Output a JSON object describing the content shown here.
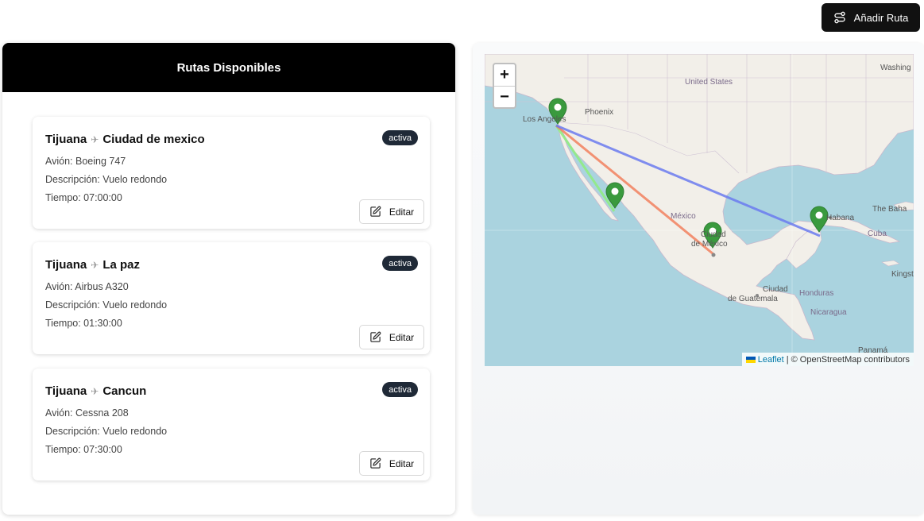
{
  "header": {
    "add_route_label": "Añadir Ruta"
  },
  "routes_panel": {
    "title": "Rutas Disponibles",
    "routes": [
      {
        "origin": "Tijuana",
        "destination": "Ciudad de mexico",
        "status": "activa",
        "aircraft": "Avión: Boeing 747",
        "description": "Descripción: Vuelo redondo",
        "time": "Tiempo: 07:00:00",
        "edit_label": "Editar"
      },
      {
        "origin": "Tijuana",
        "destination": "La paz",
        "status": "activa",
        "aircraft": "Avión: Airbus A320",
        "description": "Descripción: Vuelo redondo",
        "time": "Tiempo: 01:30:00",
        "edit_label": "Editar"
      },
      {
        "origin": "Tijuana",
        "destination": "Cancun",
        "status": "activa",
        "aircraft": "Avión: Cessna 208",
        "description": "Descripción: Vuelo redondo",
        "time": "Tiempo: 07:30:00",
        "edit_label": "Editar"
      }
    ],
    "arrow_glyph": "✈"
  },
  "map": {
    "zoom_in": "+",
    "zoom_out": "−",
    "attribution_leaflet": "Leaflet",
    "attribution_rest": "| © OpenStreetMap contributors",
    "labels": {
      "united_states": "United States",
      "phoenix": "Phoenix",
      "los_angeles": "Los Angeles",
      "washington": "Washing",
      "mexico": "México",
      "ciudad": "Ciudad",
      "de_mexico": "de México",
      "habana": "Habana",
      "the_baha": "The Baha",
      "cuba": "Cuba",
      "kingst": "Kingst",
      "ciudad_guatemala": "Ciudad",
      "de_guatemala": "de Guatemala",
      "honduras": "Honduras",
      "nicaragua": "Nicaragua",
      "panama": "Panamá"
    },
    "route_colors": {
      "cdmx": "#f2815f",
      "la_paz": "#90ee7f",
      "cancun": "#6b7bf0"
    },
    "marker_color": "#3a9a3e"
  }
}
